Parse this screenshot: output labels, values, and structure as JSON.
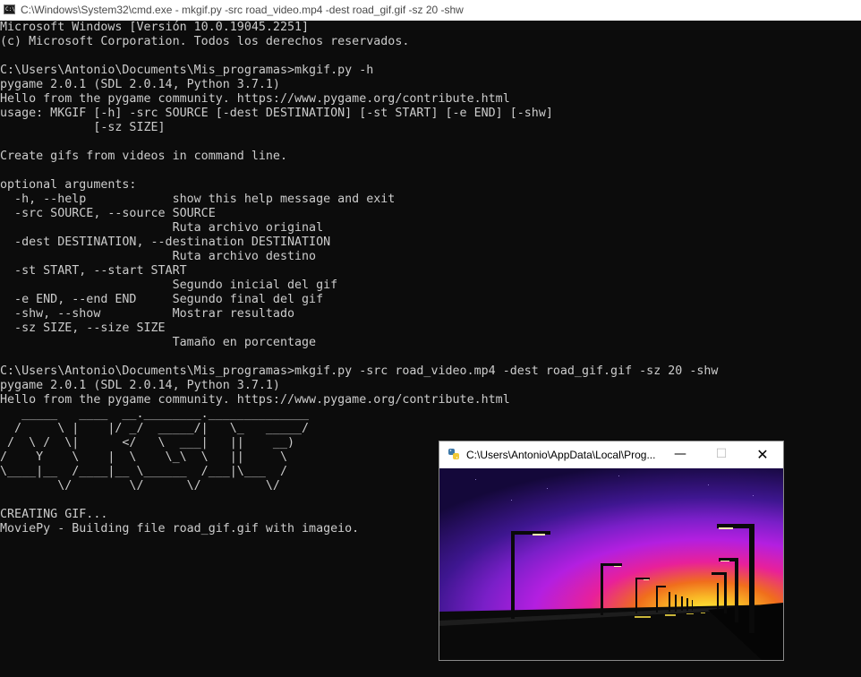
{
  "window": {
    "title": "C:\\Windows\\System32\\cmd.exe - mkgif.py  -src road_video.mp4 -dest road_gif.gif -sz 20 -shw",
    "icon": "cmd-icon"
  },
  "console_lines": [
    "Microsoft Windows [Versión 10.0.19045.2251]",
    "(c) Microsoft Corporation. Todos los derechos reservados.",
    "",
    "C:\\Users\\Antonio\\Documents\\Mis_programas>mkgif.py -h",
    "pygame 2.0.1 (SDL 2.0.14, Python 3.7.1)",
    "Hello from the pygame community. https://www.pygame.org/contribute.html",
    "usage: MKGIF [-h] -src SOURCE [-dest DESTINATION] [-st START] [-e END] [-shw]",
    "             [-sz SIZE]",
    "",
    "Create gifs from videos in command line.",
    "",
    "optional arguments:",
    "  -h, --help            show this help message and exit",
    "  -src SOURCE, --source SOURCE",
    "                        Ruta archivo original",
    "  -dest DESTINATION, --destination DESTINATION",
    "                        Ruta archivo destino",
    "  -st START, --start START",
    "                        Segundo inicial del gif",
    "  -e END, --end END     Segundo final del gif",
    "  -shw, --show          Mostrar resultado",
    "  -sz SIZE, --size SIZE",
    "                        Tamaño en porcentage",
    "",
    "C:\\Users\\Antonio\\Documents\\Mis_programas>mkgif.py -src road_video.mp4 -dest road_gif.gif -sz 20 -shw",
    "pygame 2.0.1 (SDL 2.0.14, Python 3.7.1)",
    "Hello from the pygame community. https://www.pygame.org/contribute.html",
    "   _____   ____  __.________.______________",
    "  /     \\ |    |/ _/  _____/|   \\_   _____/",
    " /  \\ /  \\|      </   \\  ___|   ||    __)",
    "/    Y    \\    |  \\    \\_\\  \\   ||     \\",
    "\\____|__  /____|__ \\______  /___|\\___  /",
    "        \\/        \\/      \\/         \\/",
    "",
    "CREATING GIF...",
    "MoviePy - Building file road_gif.gif with imageio."
  ],
  "popup": {
    "title": "C:\\Users\\Antonio\\AppData\\Local\\Prog...",
    "minimize": "—",
    "maximize": "☐",
    "close": "✕",
    "icon": "python-icon"
  },
  "colors": {
    "console_bg": "#0c0c0c",
    "console_text": "#cccccc",
    "sky_top": "#1b0a4a",
    "sky_purple": "#5a1fa6",
    "sky_magenta": "#b31fe0",
    "sky_pink": "#e8209a",
    "sky_orange": "#f06e1c",
    "sun": "#fff23a"
  }
}
